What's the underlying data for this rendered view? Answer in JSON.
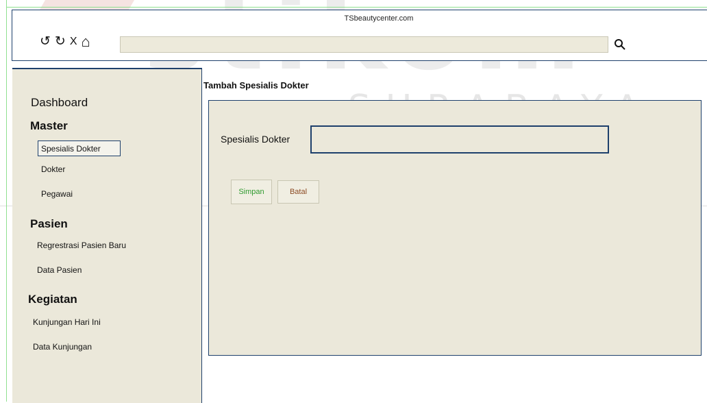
{
  "watermark": {
    "brand": "stikom",
    "city": "SURABAYA"
  },
  "browser": {
    "title": "TSbeautycenter.com",
    "address_value": "",
    "nav_icons": [
      "undo-icon",
      "reload-icon",
      "close-icon",
      "home-icon",
      "search-icon"
    ],
    "nav": {
      "back": "↺",
      "reload": "↻",
      "stop": "X",
      "home": "⌂"
    }
  },
  "sidebar": {
    "dashboard": "Dashboard",
    "master": {
      "heading": "Master",
      "items": [
        "Spesialis Dokter",
        "Dokter",
        "Pegawai"
      ]
    },
    "pasien": {
      "heading": "Pasien",
      "items": [
        "Regrestrasi Pasien Baru",
        "Data Pasien"
      ]
    },
    "kegiatan": {
      "heading": "Kegiatan",
      "items": [
        "Kunjungan Hari Ini",
        "Data Kunjungan"
      ]
    }
  },
  "main": {
    "title": "Tambah Spesialis Dokter",
    "form": {
      "spesialis_label": "Spesialis Dokter",
      "spesialis_value": ""
    },
    "buttons": {
      "save": "Simpan",
      "cancel": "Batal"
    }
  },
  "colors": {
    "border": "#1d3f6b",
    "panel_bg": "#ebe8da",
    "save_text": "#2f9a2f",
    "cancel_text": "#8b4a23"
  }
}
